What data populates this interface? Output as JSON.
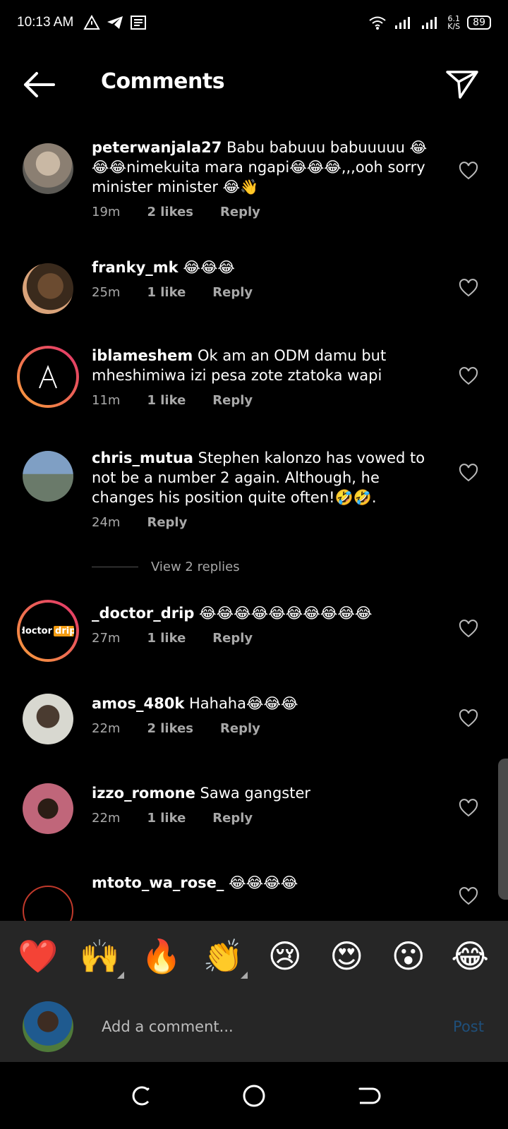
{
  "status_bar": {
    "time": "10:13 AM",
    "speed": "6.1\nK/S",
    "speed_top": "6.1",
    "speed_bottom": "K/S",
    "battery": "89"
  },
  "header": {
    "title": "Comments"
  },
  "comments": [
    {
      "username": "peterwanjala27",
      "text": "Babu babuuu babuuuuu 😂😂😂nimekuita mara ngapi😂😂😂,,,ooh sorry minister minister 😂👋",
      "time": "19m",
      "likes": "2 likes",
      "reply": "Reply"
    },
    {
      "username": "franky_mk",
      "text": "😂😂😂",
      "time": "25m",
      "likes": "1 like",
      "reply": "Reply"
    },
    {
      "username": "iblameshem",
      "text": "Ok am an ODM damu but mheshimiwa izi pesa zote ztatoka wapi",
      "time": "11m",
      "likes": "1 like",
      "reply": "Reply"
    },
    {
      "username": "chris_mutua",
      "text": "Stephen kalonzo has vowed to not be a number 2 again. Although, he changes his position quite often!🤣🤣.",
      "time": "24m",
      "likes": "",
      "reply": "Reply",
      "view_replies": "View 2 replies"
    },
    {
      "username": "_doctor_drip",
      "text": "😂😂😂😂😂😂😂😂😂😂",
      "time": "27m",
      "likes": "1 like",
      "reply": "Reply",
      "avatar_text_a": "doctor",
      "avatar_text_b": "drip"
    },
    {
      "username": "amos_480k",
      "text": "Hahaha😂😂😂",
      "time": "22m",
      "likes": "2 likes",
      "reply": "Reply"
    },
    {
      "username": "izzo_romone",
      "text": "Sawa gangster",
      "time": "22m",
      "likes": "1 like",
      "reply": "Reply"
    },
    {
      "username": "mtoto_wa_rose_",
      "text": "😂😂😂😂",
      "time": "",
      "likes": "",
      "reply": ""
    }
  ],
  "quick_reactions": [
    "❤️",
    "🙌",
    "🔥",
    "👏",
    "😢",
    "😍",
    "😮",
    "😂"
  ],
  "composer": {
    "placeholder": "Add a comment...",
    "post_label": "Post"
  },
  "colors": {
    "background": "#000000",
    "panel": "#262626",
    "muted": "#a8a8a8",
    "post_disabled": "#1f4f7a",
    "story_ring_start": "#f9a13a",
    "story_ring_end": "#e1306c"
  },
  "icons": {
    "back": "arrow-left-icon",
    "send": "paper-plane-icon",
    "heart": "heart-outline-icon"
  }
}
